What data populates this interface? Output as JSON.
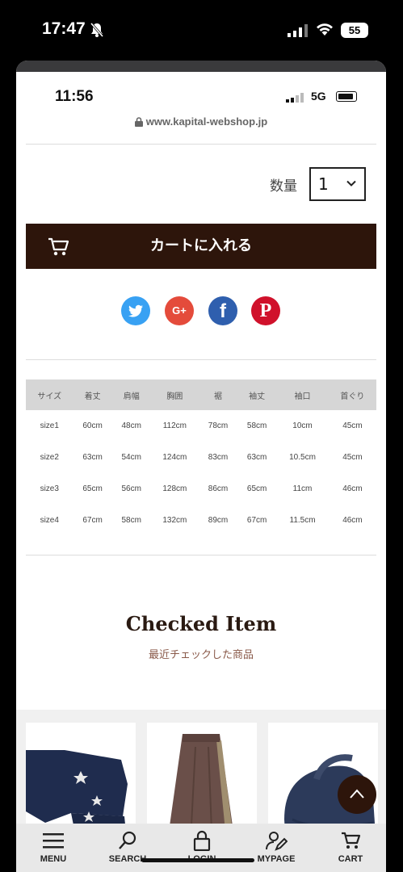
{
  "outer_status": {
    "time": "17:47",
    "battery": "55"
  },
  "inner_status": {
    "time": "11:56",
    "network": "5G"
  },
  "browser": {
    "url": "www.kapital-webshop.jp"
  },
  "quantity": {
    "label": "数量",
    "value": "1"
  },
  "cart_button": {
    "label": "カートに入れる"
  },
  "share": {
    "google_label": "G+",
    "facebook_label": "f",
    "pinterest_label": "P"
  },
  "size_table": {
    "headers": [
      "サイズ",
      "着丈",
      "肩幅",
      "胸囲",
      "裾",
      "袖丈",
      "袖口",
      "首ぐり"
    ],
    "rows": [
      [
        "size1",
        "60cm",
        "48cm",
        "112cm",
        "78cm",
        "58cm",
        "10cm",
        "45cm"
      ],
      [
        "size2",
        "63cm",
        "54cm",
        "124cm",
        "83cm",
        "63cm",
        "10.5cm",
        "45cm"
      ],
      [
        "size3",
        "65cm",
        "56cm",
        "128cm",
        "86cm",
        "65cm",
        "11cm",
        "46cm"
      ],
      [
        "size4",
        "67cm",
        "58cm",
        "132cm",
        "89cm",
        "67cm",
        "11.5cm",
        "46cm"
      ]
    ]
  },
  "checked": {
    "title": "Checked Item",
    "subtitle": "最近チェックした商品"
  },
  "bottom_nav": {
    "menu": "MENU",
    "search": "SEARCH",
    "login": "LOGIN",
    "mypage": "MYPAGE",
    "cart": "CART"
  },
  "colors": {
    "brand_brown": "#2d150b",
    "twitter": "#38a1f3",
    "google": "#e44b3b",
    "facebook": "#2f5fae",
    "pinterest": "#d0112b"
  }
}
